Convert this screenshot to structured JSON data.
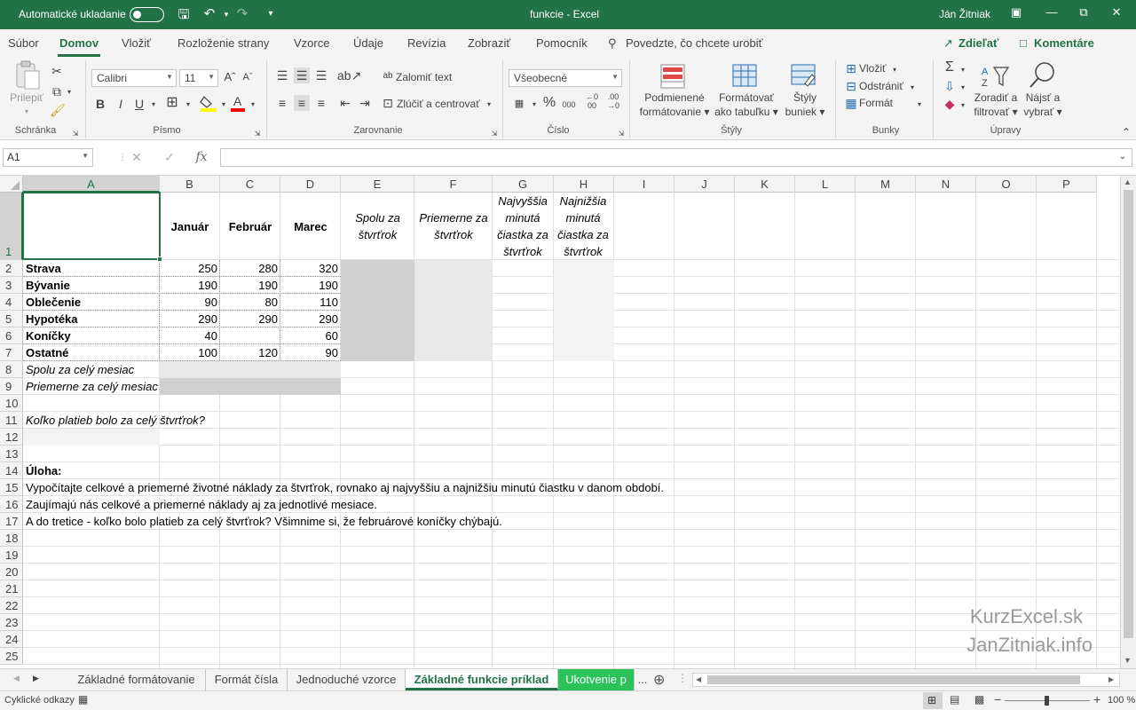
{
  "titlebar": {
    "autosave_label": "Automatické ukladanie",
    "doc_title": "funkcie  -  Excel",
    "user": "Ján Žitniak"
  },
  "menu": {
    "items": [
      "Súbor",
      "Domov",
      "Vložiť",
      "Rozloženie strany",
      "Vzorce",
      "Údaje",
      "Revízia",
      "Zobraziť",
      "Pomocník"
    ],
    "tell_me": "Povedzte, čo chcete urobiť",
    "share": "Zdieľať",
    "comments": "Komentáre"
  },
  "ribbon": {
    "clipboard": {
      "paste": "Prilepiť",
      "label": "Schránka"
    },
    "font": {
      "name": "Calibri",
      "size": "11",
      "label": "Písmo",
      "bold": "B",
      "italic": "I",
      "underline": "U"
    },
    "alignment": {
      "wrap": "Zalomiť text",
      "merge": "Zlúčiť a centrovať",
      "label": "Zarovnanie"
    },
    "number": {
      "format": "Všeobecné",
      "label": "Číslo"
    },
    "styles": {
      "conditional": [
        "Podmienené",
        "formátovanie"
      ],
      "table": [
        "Formátovať",
        "ako tabuľku"
      ],
      "cell": [
        "Štýly",
        "buniek"
      ],
      "label": "Štýly"
    },
    "cells": {
      "insert": "Vložiť",
      "delete": "Odstrániť",
      "format": "Formát",
      "label": "Bunky"
    },
    "editing": {
      "sort": [
        "Zoradiť a",
        "filtrovať"
      ],
      "find": [
        "Nájsť a",
        "vybrať"
      ],
      "label": "Úpravy"
    }
  },
  "formula": {
    "namebox": "A1",
    "fx": "fx",
    "value": ""
  },
  "grid": {
    "columns": [
      "A",
      "B",
      "C",
      "D",
      "E",
      "F",
      "G",
      "H",
      "I",
      "J",
      "K",
      "L",
      "M",
      "N",
      "O",
      "P"
    ],
    "rows": [
      "1",
      "2",
      "3",
      "4",
      "5",
      "6",
      "7",
      "8",
      "9",
      "10",
      "11",
      "12",
      "13",
      "14",
      "15",
      "16",
      "17",
      "18",
      "19",
      "20",
      "21",
      "22",
      "23",
      "24",
      "25"
    ],
    "header_row": {
      "b": "Január",
      "c": "Február",
      "d": "Marec",
      "e": "Spolu za štvrťrok",
      "f": "Priemerne za štvrťrok",
      "g": "Najvyššia minutá čiastka za štvrťrok",
      "h": "Najnižšia minutá čiastka za štvrťrok"
    },
    "data_rows": [
      {
        "label": "Strava",
        "b": "250",
        "c": "280",
        "d": "320"
      },
      {
        "label": "Bývanie",
        "b": "190",
        "c": "190",
        "d": "190"
      },
      {
        "label": "Oblečenie",
        "b": "90",
        "c": "80",
        "d": "110"
      },
      {
        "label": "Hypotéka",
        "b": "290",
        "c": "290",
        "d": "290"
      },
      {
        "label": "Koníčky",
        "b": "40",
        "c": "",
        "d": "60"
      },
      {
        "label": "Ostatné",
        "b": "100",
        "c": "120",
        "d": "90"
      }
    ],
    "row8": "Spolu za celý mesiac",
    "row9": "Priemerne za celý mesiac",
    "row11": "Koľko platieb bolo za celý štvrťrok?",
    "row14": "Úloha:",
    "row15": "Vypočítajte celkové a priemerné životné náklady za štvrťrok, rovnako aj najvyššiu a najnižšiu minutú čiastku v danom období.",
    "row16": "Zaujímajú nás celkové a priemerné náklady aj za jednotlivé mesiace.",
    "row17": "A do tretice - koľko bolo platieb za celý štvrťrok? Všimnime si, že februárové koníčky chýbajú."
  },
  "watermark": {
    "line1": "KurzExcel.sk",
    "line2": "JanZitniak.info"
  },
  "tabs": [
    "Základné formátovanie",
    "Formát čísla",
    "Jednoduché vzorce",
    "Základné funkcie príklad",
    "Ukotvenie p"
  ],
  "tabs_more": "...",
  "status": {
    "left": "Cyklické odkazy",
    "zoom": "100 %"
  },
  "colors": {
    "excel_green": "#217346",
    "shade_dark": "#d0d0d0",
    "shade_light": "#e8e8e8",
    "tab_green": "#2bc25a"
  }
}
